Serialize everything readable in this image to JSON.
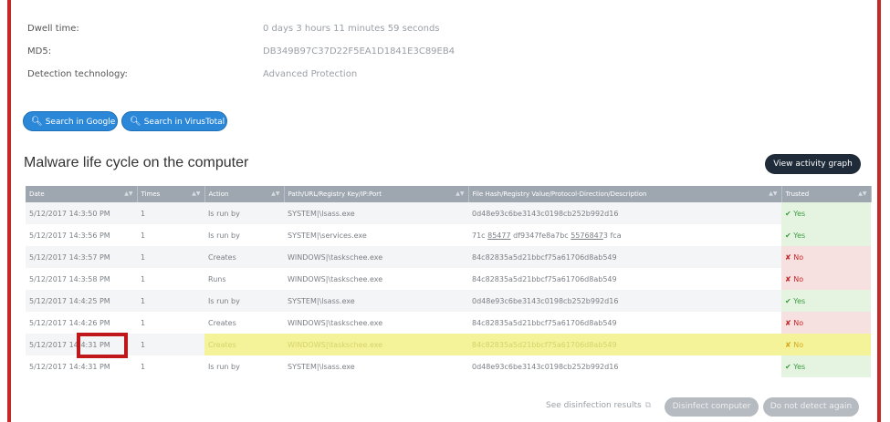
{
  "details": {
    "dwell_label": "Dwell time:",
    "dwell_value": "0 days 3 hours 11 minutes 59 seconds",
    "md5_label": "MD5:",
    "md5_value": "DB349B97C37D22F5EA1D1841E3C89EB4",
    "tech_label": "Detection technology:",
    "tech_value": "Advanced Protection"
  },
  "actions": {
    "search_google": "Search in Google",
    "search_virustotal": "Search in VirusTotal"
  },
  "lifecycle": {
    "title": "Malware life cycle on the computer",
    "view_graph": "View activity graph",
    "columns": [
      "Date",
      "Times",
      "Action",
      "Path/URL/Registry Key/IP:Port",
      "File Hash/Registry Value/Protocol-Direction/Description",
      "Trusted"
    ],
    "rows": [
      {
        "date": "5/12/2017 14:3:50 PM",
        "times": "1",
        "action": "Is run by",
        "path": "SYSTEM|\\lsass.exe",
        "hash": "0d48e93c6be3143c0198cb252b992d16",
        "trusted": "Yes"
      },
      {
        "date": "5/12/2017 14:3:56 PM",
        "times": "1",
        "action": "Is run by",
        "path": "SYSTEM|\\services.exe",
        "hash_a": "71c ",
        "hash_b": "85477",
        "hash_c": " df9347fe8a7bc ",
        "hash_d": "5576847",
        "hash_e": "3 fca",
        "trusted": "Yes"
      },
      {
        "date": "5/12/2017 14:3:57 PM",
        "times": "1",
        "action": "Creates",
        "path": "WINDOWS|\\taskschee.exe",
        "hash": "84c82835a5d21bbcf75a61706d8ab549",
        "trusted": "No"
      },
      {
        "date": "5/12/2017 14:3:58 PM",
        "times": "1",
        "action": "Runs",
        "path": "WINDOWS|\\taskschee.exe",
        "hash": "84c82835a5d21bbcf75a61706d8ab549",
        "trusted": "No"
      },
      {
        "date": "5/12/2017 14:4:25 PM",
        "times": "1",
        "action": "Is run by",
        "path": "SYSTEM|\\lsass.exe",
        "hash": "0d48e93c6be3143c0198cb252b992d16",
        "trusted": "Yes"
      },
      {
        "date": "5/12/2017 14:4:26 PM",
        "times": "1",
        "action": "Creates",
        "path": "WINDOWS|\\taskschee.exe",
        "hash": "84c82835a5d21bbcf75a61706d8ab549",
        "trusted": "No"
      },
      {
        "date": "5/12/2017 14:4:31 PM",
        "times": "1",
        "action": "Creates",
        "path": "WINDOWS|\\taskschee.exe",
        "hash": "84c82835a5d21bbcf75a61706d8ab549",
        "trusted": "No"
      },
      {
        "date": "5/12/2017 14:4:31 PM",
        "times": "1",
        "action": "Is run by",
        "path": "SYSTEM|\\lsass.exe",
        "hash": "0d48e93c6be3143c0198cb252b992d16",
        "trusted": "Yes"
      }
    ]
  },
  "footer": {
    "see_results": "See disinfection results",
    "disinfect": "Disinfect computer",
    "do_not_detect": "Do not detect again"
  },
  "icons": {
    "search": "search-icon",
    "check": "check-icon",
    "cross": "cross-icon",
    "external": "external-link-icon"
  },
  "colors": {
    "accent_blue": "#2b87d8",
    "frame_red": "#c62828",
    "highlight": "#f4f39a",
    "yes_green": "#3f9b3f",
    "no_red": "#c62828"
  }
}
